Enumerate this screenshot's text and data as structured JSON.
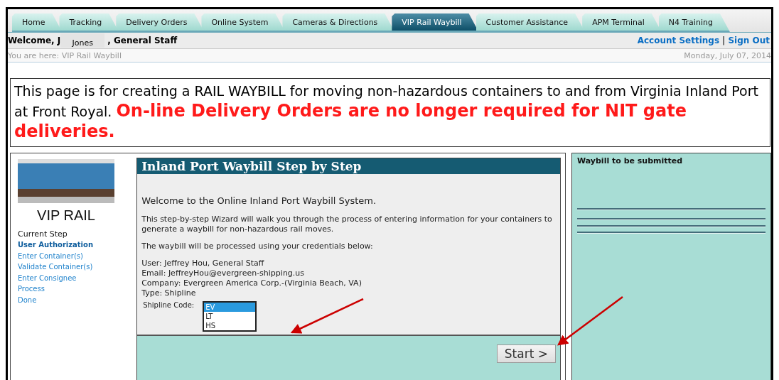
{
  "tabs": [
    {
      "label": "Home",
      "selected": false
    },
    {
      "label": "Tracking",
      "selected": false
    },
    {
      "label": "Delivery Orders",
      "selected": false
    },
    {
      "label": "Online System",
      "selected": false
    },
    {
      "label": "Cameras & Directions",
      "selected": false
    },
    {
      "label": "VIP Rail Waybill",
      "selected": true
    },
    {
      "label": "Customer Assistance",
      "selected": false
    },
    {
      "label": "APM Terminal",
      "selected": false
    },
    {
      "label": "N4 Training",
      "selected": false
    }
  ],
  "header": {
    "welcome_start": "Welcome, J",
    "welcome_end": ", General Staff",
    "popup": "Jones",
    "links": [
      "Account Settings",
      "Sign Out"
    ],
    "separator": "|"
  },
  "breadcrumb": {
    "text": "You are here: VIP Rail Waybill",
    "date": "Monday, July 07, 2014"
  },
  "notice": {
    "text": "This page is for creating a RAIL WAYBILL for moving non-hazardous containers to and from Virginia Inland Port at Front Royal.",
    "alert": "On-line Delivery Orders are no longer required for NIT gate deliveries."
  },
  "sidebar": {
    "title": "VIP RAIL",
    "steps_heading": "Current Step",
    "steps": [
      {
        "label": "User Authorization",
        "selected": true
      },
      {
        "label": "Enter Container(s)",
        "selected": false
      },
      {
        "label": "Validate Container(s)",
        "selected": false
      },
      {
        "label": "Enter Consignee",
        "selected": false
      },
      {
        "label": "Process",
        "selected": false
      },
      {
        "label": "Done",
        "selected": false
      }
    ]
  },
  "wizard": {
    "title": "Inland Port Waybill Step by Step",
    "welcome": "Welcome to the Online Inland Port Waybill System.",
    "intro": "This step-by-step Wizard will walk you through the process of entering information for your containers to generate a waybill for non-hazardous rail moves.",
    "credentials_intro": "The waybill will be processed using your credentials below:",
    "details": [
      "User: Jeffrey Hou, General Staff",
      "Email: JeffreyHou@evergreen-shipping.us",
      "Company: Evergreen America Corp.-(Virginia Beach, VA)",
      "Type: Shipline"
    ],
    "shipline_label": "Shipline Code:",
    "shipline_options": [
      {
        "label": "EV",
        "selected": true
      },
      {
        "label": "LT",
        "selected": false
      },
      {
        "label": "HS",
        "selected": false
      }
    ],
    "start_button": "Start >"
  },
  "summary": {
    "title": "Waybill to be submitted"
  }
}
